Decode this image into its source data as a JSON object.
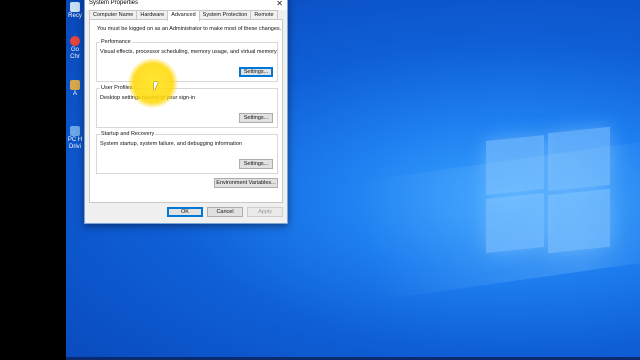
{
  "desktop": {
    "icons": [
      {
        "label": "Recy",
        "color": "#c9dff5",
        "icon": "recycle-bin-icon"
      },
      {
        "label": "Go Chr",
        "color": "#e8453c",
        "icon": "chrome-icon"
      },
      {
        "label": "A",
        "color": "#d4a84b",
        "icon": "shortcut-icon"
      },
      {
        "label": "PC H Drivi",
        "color": "#6aa7e8",
        "icon": "pc-icon"
      }
    ]
  },
  "dialog": {
    "title": "System Properties",
    "close_glyph": "✕",
    "tabs": [
      "Computer Name",
      "Hardware",
      "Advanced",
      "System Protection",
      "Remote"
    ],
    "active_tab": "Advanced",
    "admin_note": "You must be logged on as an Administrator to make most of these changes.",
    "performance": {
      "title": "Perfomance",
      "desc": "Visual effects, processor scheduling, memory usage, and virtual memory",
      "button": "Settings..."
    },
    "user_profiles": {
      "title": "User Profiles",
      "desc": "Desktop settings related to your sign-in",
      "button": "Settings..."
    },
    "startup_recovery": {
      "title": "Startup and Recovery",
      "desc": "System startup, system failure, and debugging information",
      "button": "Settings..."
    },
    "env_button": "Environment Variables...",
    "ok": "OK",
    "cancel": "Cancel",
    "apply": "Apply"
  }
}
